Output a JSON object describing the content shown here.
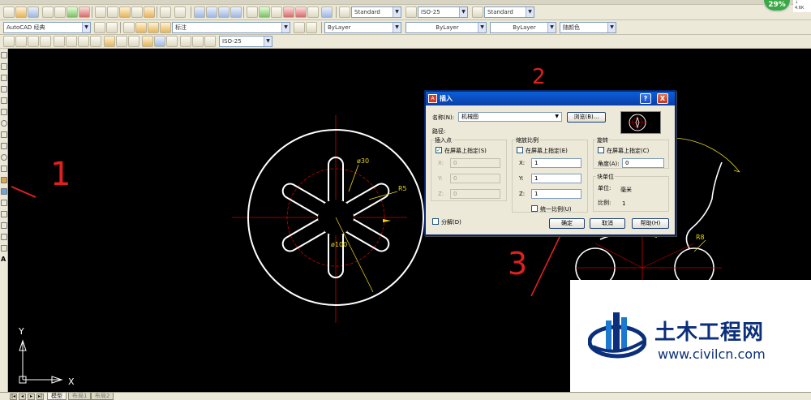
{
  "toolbar": {
    "workspace": "AutoCAD 经典",
    "annotation_label": "标注",
    "text_style": "Standard",
    "dim_style": "ISO-25",
    "table_style": "Standard",
    "dim_style_2": "ISO-25",
    "layer_color": "ByLayer",
    "linetype": "ByLayer",
    "lineweight": "ByLayer",
    "plot_color": "随颜色"
  },
  "status_badge": "29%",
  "net_info": [
    "4.6K",
    "↓"
  ],
  "drawing": {
    "dim_phi30": "ø30",
    "dim_r5": "R5",
    "dim_phi100": "ø100",
    "dim_r8": "R8",
    "ucs_x": "X",
    "ucs_y": "Y"
  },
  "annotations": {
    "mark1": "1",
    "mark2": "2",
    "mark3": "3"
  },
  "layout_tabs": [
    "模型",
    "布局1",
    "布局2"
  ],
  "dialog": {
    "title": "插入",
    "help_btn": "?",
    "close_btn": "X",
    "name_label": "名称(N):",
    "name_value": "机械图",
    "browse_btn": "浏览(B)...",
    "path_label": "路径:",
    "insertion": {
      "caption": "插入点",
      "on_screen": "在屏幕上指定(S)",
      "x_label": "X:",
      "x_value": "0",
      "y_label": "Y:",
      "y_value": "0",
      "z_label": "Z:",
      "z_value": "0"
    },
    "scale": {
      "caption": "缩放比例",
      "on_screen": "在屏幕上指定(E)",
      "x_label": "X:",
      "x_value": "1",
      "y_label": "Y:",
      "y_value": "1",
      "z_label": "Z:",
      "z_value": "1",
      "uniform": "统一比例(U)"
    },
    "rotation": {
      "caption": "旋转",
      "on_screen": "在屏幕上指定(C)",
      "angle_label": "角度(A):",
      "angle_value": "0"
    },
    "block_unit": {
      "caption": "块单位",
      "unit_label": "单位:",
      "unit_value": "毫米",
      "factor_label": "比例:",
      "factor_value": "1"
    },
    "explode": "分解(D)",
    "ok_btn": "确定",
    "cancel_btn": "取消",
    "help_btn2": "帮助(H)"
  },
  "watermark": {
    "title": "土木工程网",
    "url": "www.civilcn.com"
  },
  "colors": {
    "canvas": "#000000",
    "geometry": "#ffffff",
    "center_line": "#cc0000",
    "dimension": "#e6d619",
    "annotation": "#e02020",
    "dialog_title": "#0a46b8",
    "watermark_blue": "#0b2f7a"
  }
}
